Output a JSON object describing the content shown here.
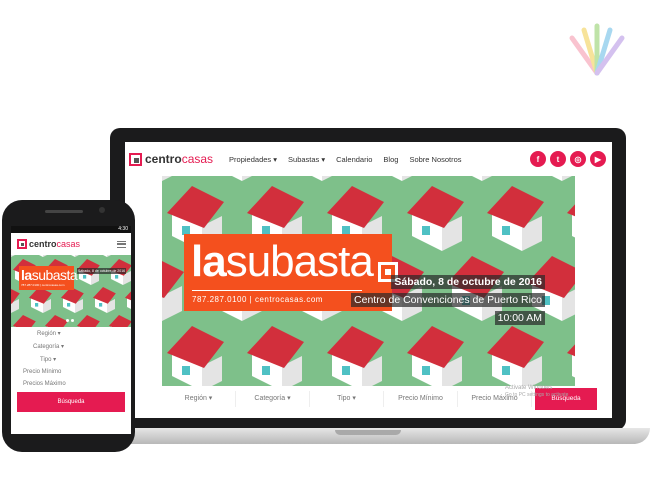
{
  "brand": {
    "name_bold": "centro",
    "name_light": "casas"
  },
  "nav": {
    "items": [
      "Propiedades ▾",
      "Subastas ▾",
      "Calendario",
      "Blog",
      "Sobre Nosotros"
    ]
  },
  "social": {
    "facebook": "f",
    "twitter": "t",
    "instagram": "◎",
    "youtube": "▶"
  },
  "hero": {
    "title_bold": "la",
    "title_light": "subasta",
    "contact": "787.287.0100 | centrocasas.com",
    "date_line1": "Sábado, 8 de octubre de 2016",
    "date_line2": "Centro de Convenciones de Puerto Rico",
    "date_line3": "10:00 AM"
  },
  "search": {
    "region": "Región ▾",
    "categoria": "Categoría ▾",
    "tipo": "Tipo ▾",
    "precio_min": "Precio Mínimo",
    "precio_max": "Precio Máximo",
    "button": "Búsqueda"
  },
  "watermark": {
    "line1": "Activate Windows",
    "line2": "Go to PC settings to activate"
  },
  "phone": {
    "status_time": "4:30",
    "hero_date": "Sábado, 8 de octubre de 2016",
    "fields": [
      "Región ▾",
      "Categoría ▾",
      "Tipo ▾",
      "Precio Mínimo",
      "Precios Máximo"
    ],
    "button": "Búsqueda"
  },
  "colors": {
    "brand": "#e51b51",
    "hero_orange": "#f4501e",
    "hero_green": "#7ec08a",
    "roof_red": "#d22f3c"
  }
}
